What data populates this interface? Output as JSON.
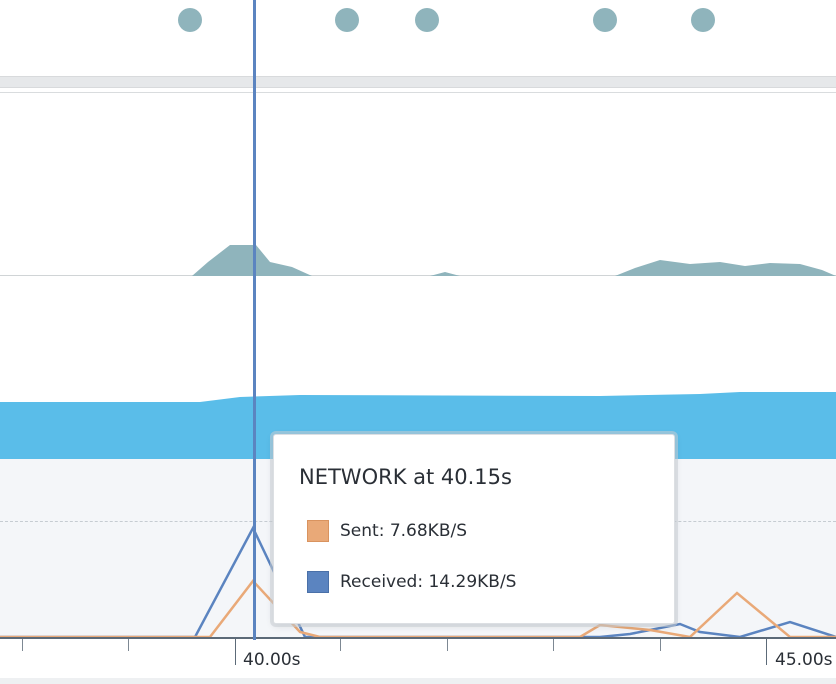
{
  "timeline": {
    "axis": {
      "tick_labels": [
        "40.00s",
        "45.00s"
      ]
    },
    "cursor": {
      "time_s": 40.15
    }
  },
  "tooltip": {
    "title": "NETWORK at 40.15s",
    "items": [
      {
        "label": "Sent: 7.68KB/S",
        "color": "#e9a978"
      },
      {
        "label": "Received: 14.29KB/S",
        "color": "#5b84c0"
      }
    ]
  },
  "colors": {
    "event_dot": "#8fb4bc",
    "cpu_area": "#8fb4bc",
    "memory_area": "#5abde9",
    "sent": "#e9a978",
    "received": "#5b84c0"
  },
  "icons": {
    "event_marker": "circle-dot"
  }
}
